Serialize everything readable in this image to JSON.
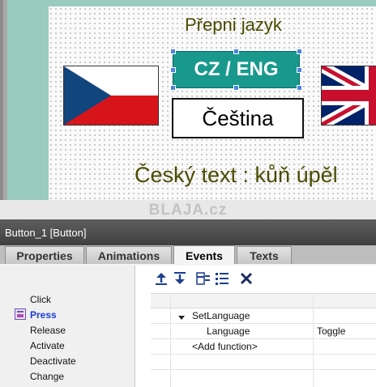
{
  "canvas": {
    "title": "Přepni jazyk",
    "language_button_label": "CZ / ENG",
    "language_display": "Čeština",
    "czech_text": "Český text : kůň úpěl"
  },
  "watermark": "BLAJA.cz",
  "panel": {
    "title": "Button_1 [Button]",
    "tabs": [
      {
        "label": "Properties"
      },
      {
        "label": "Animations"
      },
      {
        "label": "Events"
      },
      {
        "label": "Texts"
      }
    ],
    "active_tab": "Events",
    "toolbar_icons": [
      "move-up-icon",
      "move-down-icon",
      "select-list-icon",
      "list-icon",
      "delete-icon"
    ],
    "events": [
      {
        "label": "Click"
      },
      {
        "label": "Press"
      },
      {
        "label": "Release"
      },
      {
        "label": "Activate"
      },
      {
        "label": "Deactivate"
      },
      {
        "label": "Change"
      }
    ],
    "selected_event": "Press",
    "functions": {
      "name": "SetLanguage",
      "param_name": "Language",
      "param_value": "Toggle",
      "add_function": "<Add function>"
    }
  },
  "colors": {
    "button_teal": "#19998d",
    "frame_teal": "#99cbbe",
    "text_olive": "#4a4a00",
    "selected_event_blue": "#1a3ad6"
  }
}
